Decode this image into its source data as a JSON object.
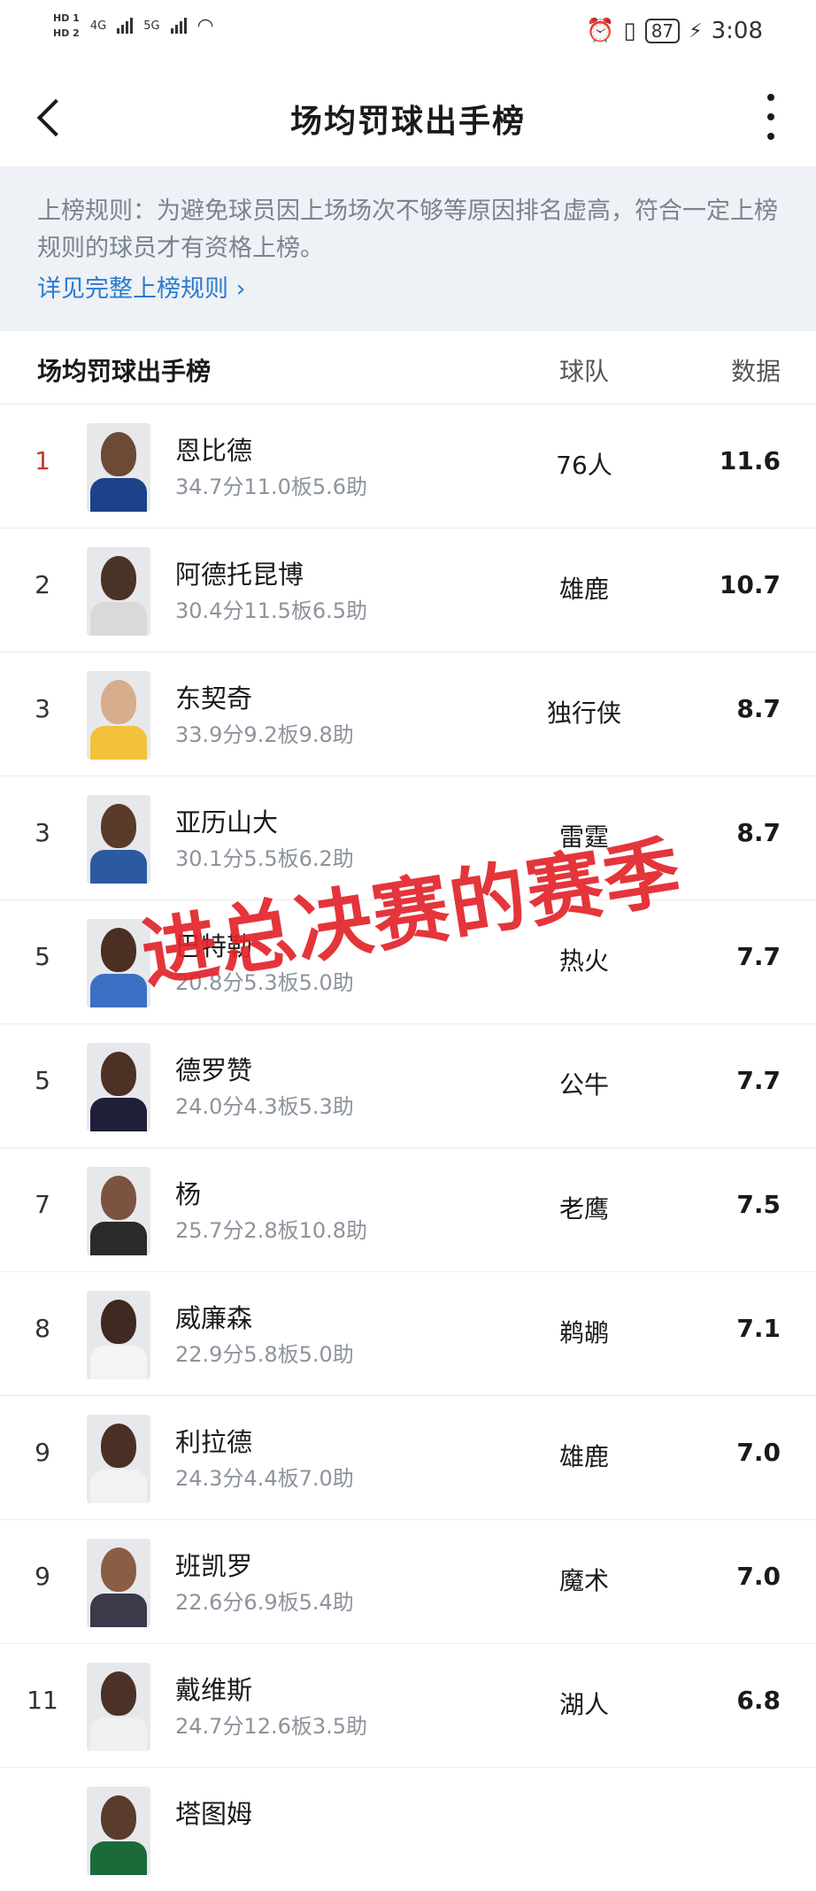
{
  "status_bar": {
    "hd1": "HD 1",
    "hd2": "HD 2",
    "net1": "4G",
    "net2": "5G",
    "battery": "87",
    "time": "3:08"
  },
  "header": {
    "title": "场均罚球出手榜"
  },
  "rule": {
    "text": "上榜规则：为避免球员因上场场次不够等原因排名虚高，符合一定上榜规则的球员才有资格上榜。",
    "link": "详见完整上榜规则 ›"
  },
  "table": {
    "col_name": "场均罚球出手榜",
    "col_team": "球队",
    "col_data": "数据",
    "rows": [
      {
        "rank": "1",
        "name": "恩比德",
        "stats": "34.7分11.0板5.6助",
        "team": "76人",
        "value": "11.6"
      },
      {
        "rank": "2",
        "name": "阿德托昆博",
        "stats": "30.4分11.5板6.5助",
        "team": "雄鹿",
        "value": "10.7"
      },
      {
        "rank": "3",
        "name": "东契奇",
        "stats": "33.9分9.2板9.8助",
        "team": "独行侠",
        "value": "8.7"
      },
      {
        "rank": "3",
        "name": "亚历山大",
        "stats": "30.1分5.5板6.2助",
        "team": "雷霆",
        "value": "8.7"
      },
      {
        "rank": "5",
        "name": "巴特勒",
        "stats": "20.8分5.3板5.0助",
        "team": "热火",
        "value": "7.7"
      },
      {
        "rank": "5",
        "name": "德罗赞",
        "stats": "24.0分4.3板5.3助",
        "team": "公牛",
        "value": "7.7"
      },
      {
        "rank": "7",
        "name": "杨",
        "stats": "25.7分2.8板10.8助",
        "team": "老鹰",
        "value": "7.5"
      },
      {
        "rank": "8",
        "name": "威廉森",
        "stats": "22.9分5.8板5.0助",
        "team": "鹈鹕",
        "value": "7.1"
      },
      {
        "rank": "9",
        "name": "利拉德",
        "stats": "24.3分4.4板7.0助",
        "team": "雄鹿",
        "value": "7.0"
      },
      {
        "rank": "9",
        "name": "班凯罗",
        "stats": "22.6分6.9板5.4助",
        "team": "魔术",
        "value": "7.0"
      },
      {
        "rank": "11",
        "name": "戴维斯",
        "stats": "24.7分12.6板3.5助",
        "team": "湖人",
        "value": "6.8"
      },
      {
        "rank": "",
        "name": "塔图姆",
        "stats": "",
        "team": "",
        "value": ""
      }
    ]
  },
  "overlay_text": "进总决赛的赛季",
  "colors": {
    "rank_first": "#c0392b",
    "link": "#2a7ad2",
    "overlay": "#e2242b",
    "rule_bg": "#eef1f5"
  }
}
